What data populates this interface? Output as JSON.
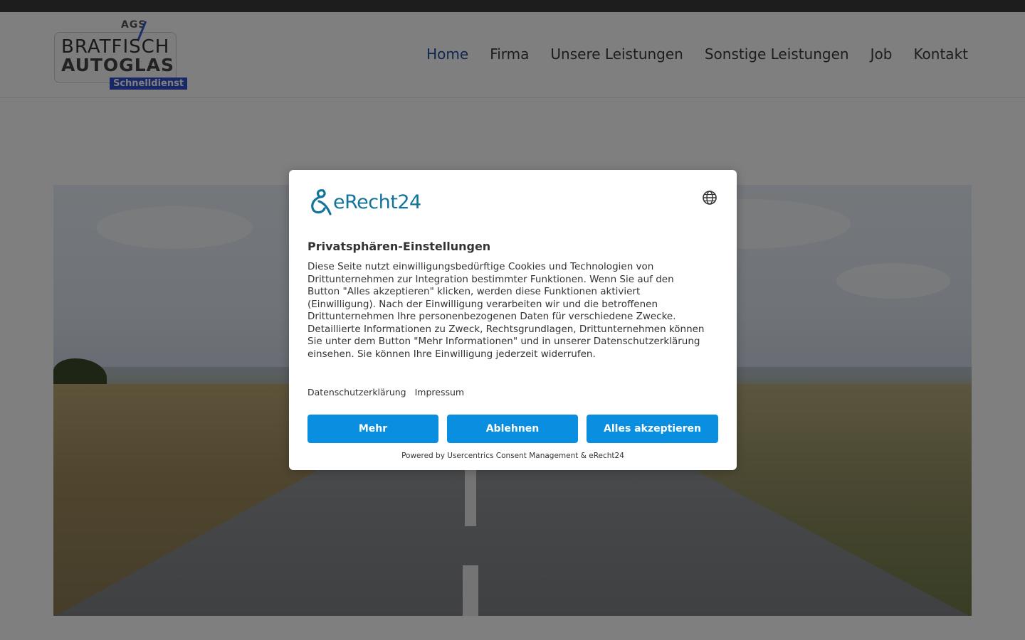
{
  "logo": {
    "top_text": "AGS",
    "line1": "BRATFISCH",
    "line2": "AUTOGLAS",
    "badge": "Schnelldienst"
  },
  "nav": {
    "items": [
      {
        "label": "Home",
        "active": true
      },
      {
        "label": "Firma",
        "active": false
      },
      {
        "label": "Unsere Leistungen",
        "active": false
      },
      {
        "label": "Sonstige Leistungen",
        "active": false
      },
      {
        "label": "Job",
        "active": false
      },
      {
        "label": "Kontakt",
        "active": false
      }
    ]
  },
  "consent": {
    "brand_name": "eRecht24",
    "language_icon": "globe-icon",
    "title": "Privatsphären-Einstellungen",
    "body": "Diese Seite nutzt einwilligungsbedürftige Cookies und Technologien von Drittunternehmen zur Integration bestimmter Funktionen. Wenn Sie auf den Button \"Alles akzeptieren\" klicken, werden diese Funktionen aktiviert (Einwilligung). Nach der Einwilligung verarbeiten wir und die betroffenen Drittunternehmen Ihre personenbezogenen Daten für verschiedene Zwecke. Detaillierte Informationen zu Zweck, Rechtsgrundlagen, Drittunternehmen können Sie unter dem Button \"Mehr Informationen\" und in unserer Datenschutzerklärung einsehen. Sie können Ihre Einwilligung jederzeit widerrufen.",
    "links": {
      "privacy": "Datenschutzerklärung",
      "imprint": "Impressum"
    },
    "buttons": {
      "more": "Mehr",
      "deny": "Ablehnen",
      "accept_all": "Alles akzeptieren"
    },
    "powered_by": "Powered by Usercentrics Consent Management & eRecht24"
  },
  "colors": {
    "accent": "#0a8ee0",
    "brand": "#12749a",
    "nav_active": "#1e4fa0",
    "logo_badge": "#2f4fd0"
  }
}
